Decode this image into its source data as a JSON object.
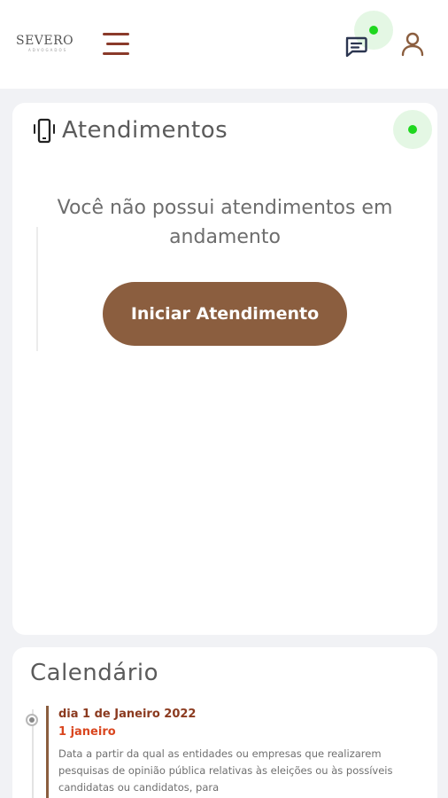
{
  "header": {
    "logo_main": "SEVERO",
    "logo_sub": "ADVOGADOS",
    "icons": {
      "menu": "hamburger-icon",
      "chat": "chat-icon",
      "user": "user-icon"
    },
    "colors": {
      "menu": "#8a3a2a",
      "online": "#1fd71f"
    }
  },
  "atendimentos": {
    "title": "Atendimentos",
    "empty_message": "Você não possui atendimentos em andamento",
    "start_button": "Iniciar Atendimento",
    "icon": "phone-vibrate-icon",
    "colors": {
      "button": "#8b5e3f",
      "online": "#1fd71f"
    }
  },
  "calendario": {
    "title": "Calendário",
    "events": [
      {
        "date": "dia 1 de Janeiro 2022",
        "name": "1 janeiro",
        "description": "Data a partir da qual as entidades ou empresas que realizarem pesquisas de opinião pública relativas às eleições ou às possíveis candidatas ou candidatos, para"
      }
    ],
    "colors": {
      "date": "#8b3a1f",
      "name": "#d9451e",
      "bar": "#8b5e3f"
    }
  }
}
